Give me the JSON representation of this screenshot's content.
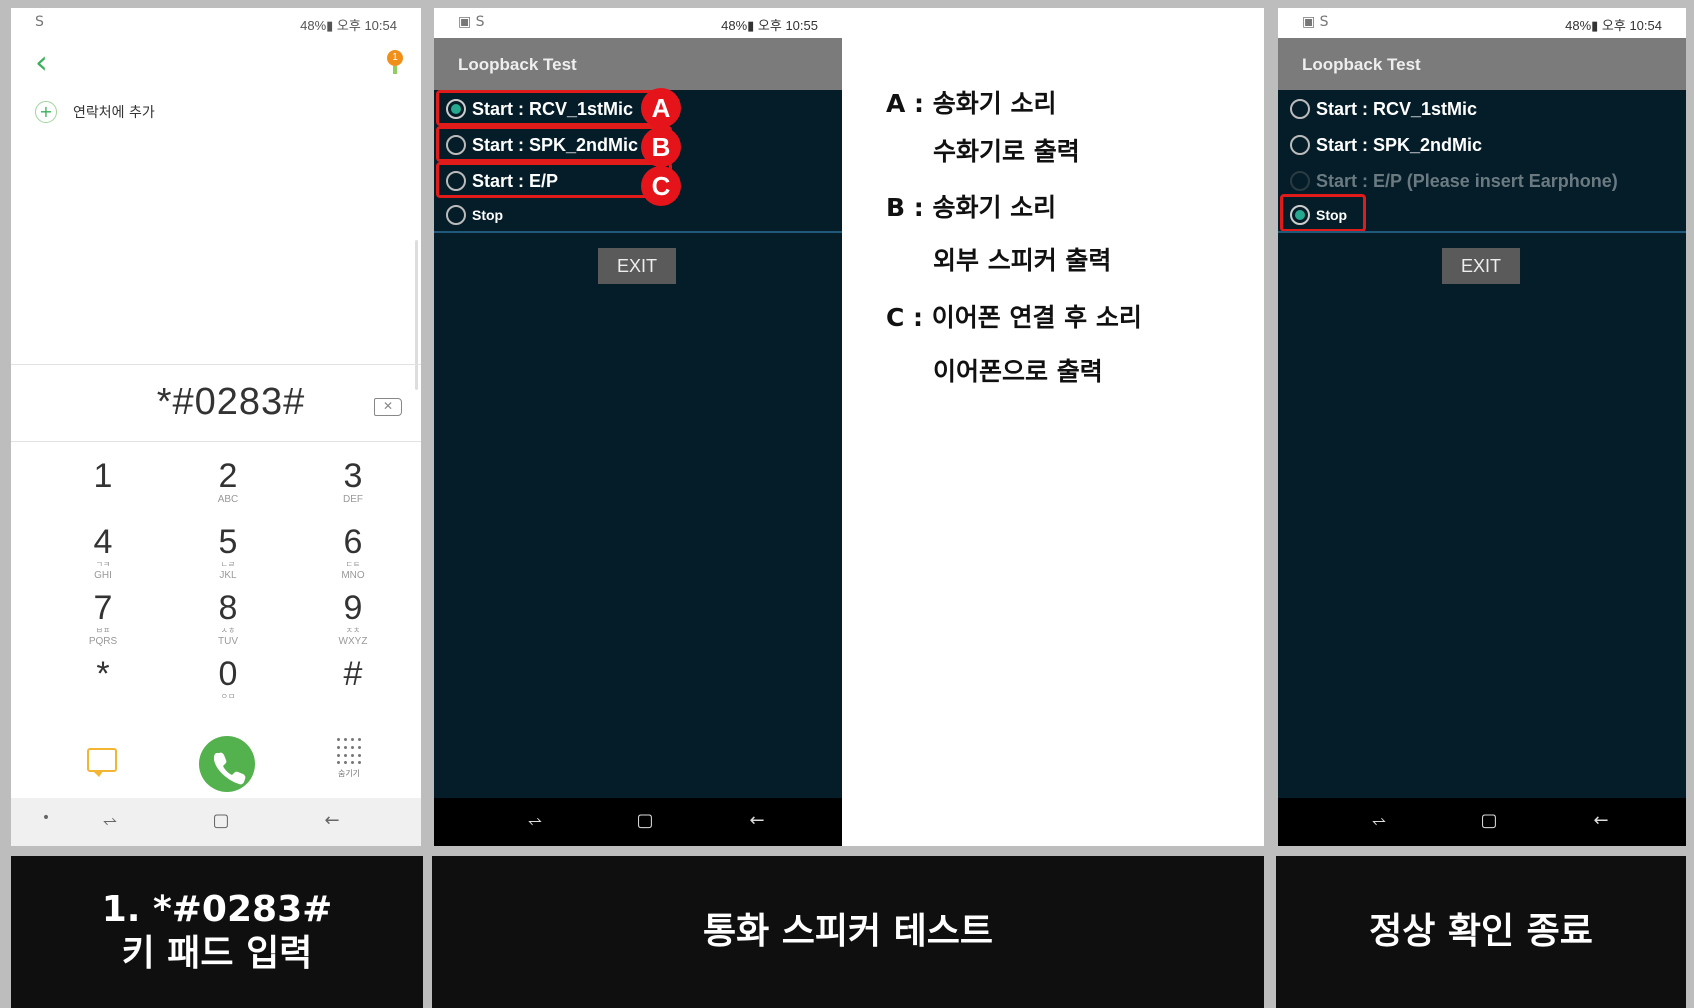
{
  "dialer": {
    "status_time": "48%▮ 오후 10:54",
    "add_contact": "연락처에 추가",
    "notif_count": "1",
    "number": "*#0283#",
    "keys": [
      {
        "digit": "1",
        "ko": "",
        "en": ""
      },
      {
        "digit": "2",
        "ko": "",
        "en": "ABC"
      },
      {
        "digit": "3",
        "ko": "",
        "en": "DEF"
      },
      {
        "digit": "4",
        "ko": "ㄱㅋ",
        "en": "GHI"
      },
      {
        "digit": "5",
        "ko": "ㄴㄹ",
        "en": "JKL"
      },
      {
        "digit": "6",
        "ko": "ㄷㅌ",
        "en": "MNO"
      },
      {
        "digit": "7",
        "ko": "ㅂㅍ",
        "en": "PQRS"
      },
      {
        "digit": "8",
        "ko": "ㅅㅎ",
        "en": "TUV"
      },
      {
        "digit": "9",
        "ko": "ㅈㅊ",
        "en": "WXYZ"
      },
      {
        "digit": "*",
        "ko": "",
        "en": ""
      },
      {
        "digit": "0",
        "ko": "ㅇㅁ",
        "en": ""
      },
      {
        "digit": "#",
        "ko": "",
        "en": ""
      }
    ],
    "hide_label": "숨기기"
  },
  "phone2": {
    "status_time": "48%▮ 오후 10:55",
    "title": "Loopback Test",
    "options": [
      {
        "label": "Start : RCV_1stMic",
        "selected": true
      },
      {
        "label": "Start : SPK_2ndMic",
        "selected": false
      },
      {
        "label": "Start : E/P",
        "selected": false
      },
      {
        "label": "Stop",
        "selected": false
      }
    ],
    "badges": [
      "A",
      "B",
      "C"
    ],
    "exit_label": "EXIT"
  },
  "legend": {
    "a_line1": "A : 송화기 소리",
    "a_line2": "수화기로 출력",
    "b_line1": "B : 송화기 소리",
    "b_line2": "외부 스피커 출력",
    "c_line1": "C :  이어폰 연결 후 소리",
    "c_line2": "이어폰으로 출력"
  },
  "phone3": {
    "status_time": "48%▮ 오후 10:54",
    "title": "Loopback Test",
    "options": [
      {
        "label": "Start : RCV_1stMic",
        "selected": false
      },
      {
        "label": "Start : SPK_2ndMic",
        "selected": false
      },
      {
        "label": "Start : E/P (Please insert Earphone)",
        "selected": false,
        "disabled": true
      },
      {
        "label": "Stop",
        "selected": true
      }
    ],
    "exit_label": "EXIT"
  },
  "captions": {
    "step1_line1": "1. *#0283#",
    "step1_line2": "키 패드 입력",
    "step2": "통화 스피커 테스트",
    "step3": "정상 확인 종료"
  },
  "colors": {
    "highlight": "#e11a1a",
    "radio_selected": "#27a990",
    "call_button": "#53b24d",
    "app_bg": "#041d28"
  }
}
